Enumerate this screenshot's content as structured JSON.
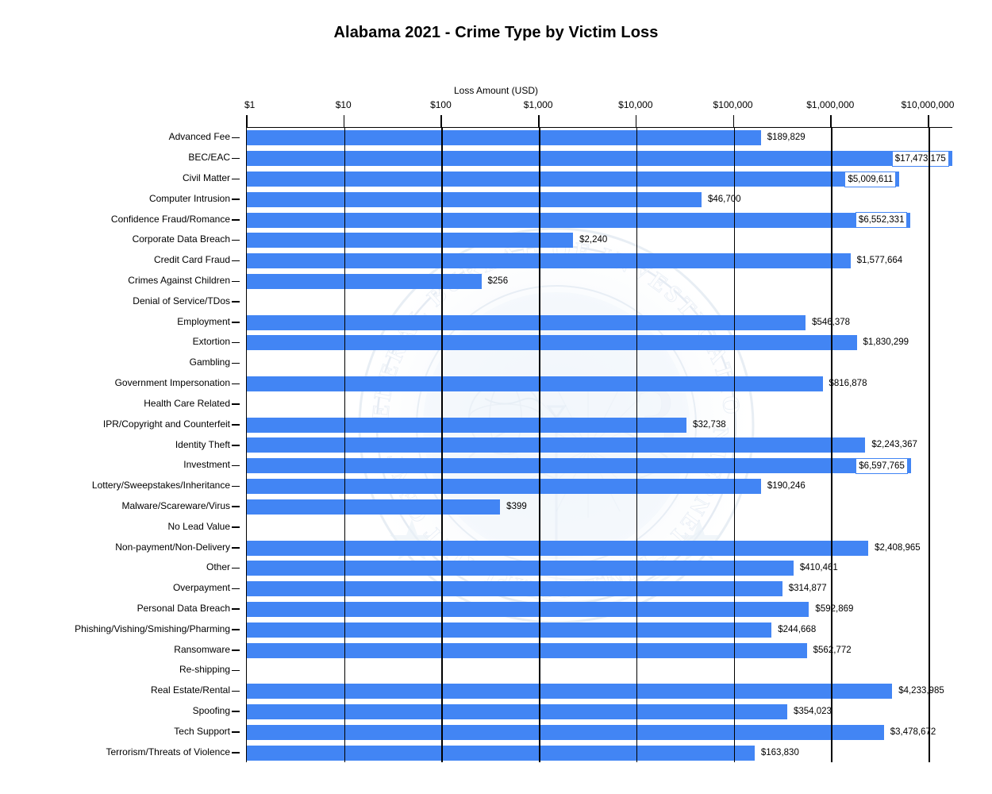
{
  "chart_data": {
    "type": "bar",
    "orientation": "horizontal",
    "title": "Alabama 2021 - Crime Type by Victim Loss",
    "xlabel": "Loss Amount (USD)",
    "ylabel": "",
    "xscale": "log",
    "xlim": [
      1,
      10000000
    ],
    "xticks": [
      1,
      10,
      100,
      1000,
      10000,
      100000,
      1000000,
      10000000
    ],
    "xticklabels": [
      "$1",
      "$10",
      "$100",
      "$1,000",
      "$10,000",
      "$100,000",
      "$1,000,000",
      "$10,000,000"
    ],
    "grid": true,
    "legend": null,
    "bar_color": "#4285F4",
    "categories": [
      "Advanced Fee",
      "BEC/EAC",
      "Civil Matter",
      "Computer Intrusion",
      "Confidence Fraud/Romance",
      "Corporate Data Breach",
      "Credit Card Fraud",
      "Crimes Against Children",
      "Denial of Service/TDos",
      "Employment",
      "Extortion",
      "Gambling",
      "Government Impersonation",
      "Health Care Related",
      "IPR/Copyright and Counterfeit",
      "Identity Theft",
      "Investment",
      "Lottery/Sweepstakes/Inheritance",
      "Malware/Scareware/Virus",
      "No Lead Value",
      "Non-payment/Non-Delivery",
      "Other",
      "Overpayment",
      "Personal Data Breach",
      "Phishing/Vishing/Smishing/Pharming",
      "Ransomware",
      "Re-shipping",
      "Real Estate/Rental",
      "Spoofing",
      "Tech Support",
      "Terrorism/Threats of Violence"
    ],
    "values": [
      189829,
      17473175,
      5009611,
      46700,
      6552331,
      2240,
      1577664,
      256,
      0,
      546378,
      1830299,
      0,
      816878,
      0,
      32738,
      2243367,
      6597765,
      190246,
      399,
      0,
      2408965,
      410461,
      314877,
      592869,
      244668,
      562772,
      0,
      4233985,
      354023,
      3478672,
      163830
    ],
    "value_labels": [
      "$189,829",
      "$17,473,175",
      "$5,009,611",
      "$46,700",
      "$6,552,331",
      "$2,240",
      "$1,577,664",
      "$256",
      "",
      "$546,378",
      "$1,830,299",
      "",
      "$816,878",
      "",
      "$32,738",
      "$2,243,367",
      "$6,597,765",
      "$190,246",
      "$399",
      "",
      "$2,408,965",
      "$410,461",
      "$314,877",
      "$592,869",
      "$244,668",
      "$562,772",
      "",
      "$4,233,985",
      "$354,023",
      "$3,478,672",
      "$163,830"
    ]
  },
  "watermark": {
    "outer_text": "FEDERAL BUREAU OF INVESTIGATION",
    "inner_text": "INTERNET CRIME COMPLAINT CENTER",
    "center_text": "IC3"
  }
}
